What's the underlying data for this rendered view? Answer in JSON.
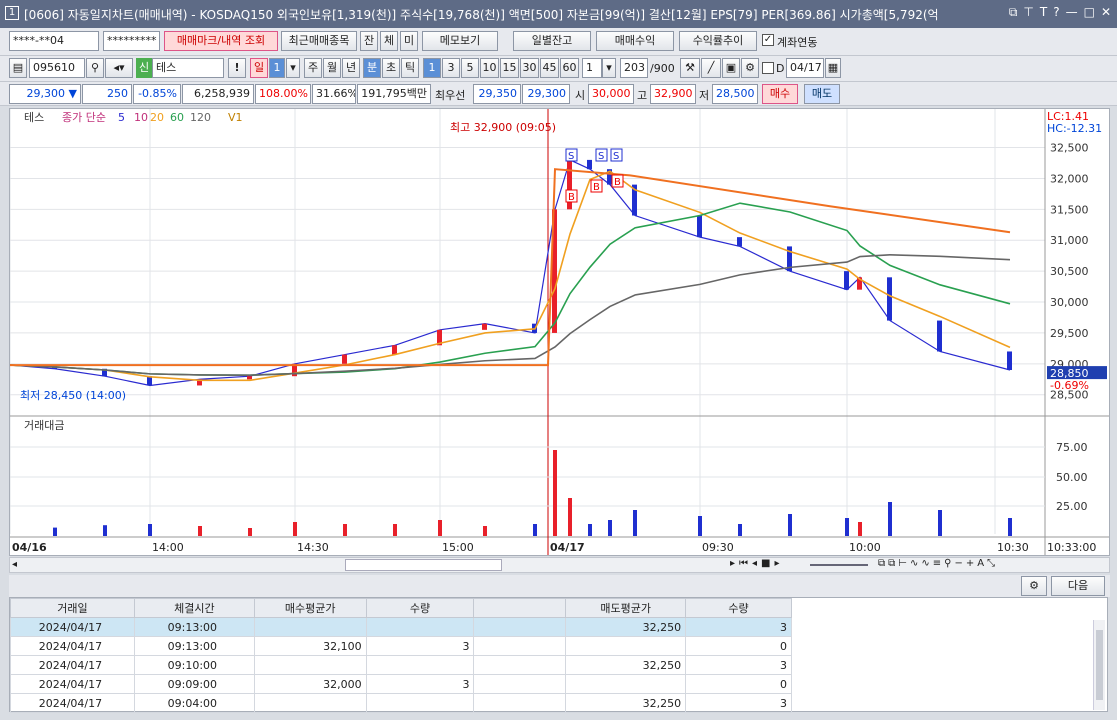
{
  "window": {
    "number": "1",
    "title": "[0606] 자동일지차트(매매내역) - KOSDAQ150 외국인보유[1,319(천)] 주식수[19,768(천)] 액면[500] 자본금[99(억)] 결산[12월] EPS[79] PER[369.86] 시가총액[5,792(억"
  },
  "row1": {
    "account": "****-**04",
    "password": "*********",
    "query_btn": "매매마크/내역 조회",
    "recent_btn": "최근매매종목",
    "tab_jan": "잔",
    "tab_che": "체",
    "tab_mi": "미",
    "memo_btn": "메모보기",
    "daily_btn": "일별잔고",
    "profit_btn": "매매수익",
    "trend_btn": "수익률추이",
    "link_label": "계좌연동"
  },
  "row2": {
    "code": "095610",
    "badge": "신",
    "name": "테스",
    "periods": [
      "일",
      "1",
      "주",
      "월",
      "년",
      "분",
      "초",
      "틱"
    ],
    "intervals": [
      "1",
      "3",
      "5",
      "10",
      "15",
      "30",
      "45",
      "60"
    ],
    "multiplier": "1",
    "count": "203",
    "max": "/900",
    "d_label": "D",
    "date": "04/17"
  },
  "row3": {
    "price": "29,300",
    "arrow": "▼",
    "change": "250",
    "pct": "-0.85%",
    "volume": "6,258,939",
    "vol_ratio": "108.00%",
    "turnover": "31.66%",
    "amount": "191,795백만",
    "best_label": "최우선",
    "best_ask": "29,350",
    "best_bid": "29,300",
    "open_label": "시",
    "open": "30,000",
    "high_label": "고",
    "high": "32,900",
    "low_label": "저",
    "low": "28,500",
    "buy_btn": "매수",
    "sell_btn": "매도"
  },
  "chart_data": {
    "type": "line",
    "legend": {
      "name": "테스",
      "ma_label": "종가 단순",
      "periods": [
        "5",
        "10",
        "20",
        "60",
        "120"
      ],
      "volume_label": "V1"
    },
    "y_ticks": [
      "32,500",
      "32,000",
      "31,500",
      "31,000",
      "30,500",
      "30,000",
      "29,500",
      "29,000",
      "28,500"
    ],
    "ylim": [
      28350,
      32800
    ],
    "lc": "LC:1.41",
    "hc": "HC:-12.31",
    "current_price": "28,850",
    "current_pct": "-0.69%",
    "high_annotation": "최고 32,900 (09:05)",
    "low_annotation": "최저 28,450 (14:00)",
    "x_ticks": [
      "04/16",
      "14:00",
      "14:30",
      "15:00",
      "04/17",
      "09:30",
      "10:00",
      "10:30"
    ],
    "time_label": "10:33:00",
    "volume_panel_title": "거래대금",
    "volume_ticks": [
      "75.00",
      "50.00",
      "25.00"
    ],
    "trade_marks": [
      "S",
      "S",
      "S",
      "B",
      "B",
      "B"
    ],
    "colors": {
      "up": "#e8202a",
      "down": "#1f2fd0",
      "ma5": "#2a2ad0",
      "ma20": "#f0a020",
      "ma60": "#29a050",
      "ma120": "#666666",
      "long": "#f07020"
    },
    "close_points": [
      {
        "t": "13:30",
        "p": 28980
      },
      {
        "t": "13:40",
        "p": 28920
      },
      {
        "t": "13:50",
        "p": 28800
      },
      {
        "t": "14:00",
        "p": 28650
      },
      {
        "t": "14:10",
        "p": 28750
      },
      {
        "t": "14:20",
        "p": 28800
      },
      {
        "t": "14:30",
        "p": 29000
      },
      {
        "t": "14:40",
        "p": 29150
      },
      {
        "t": "14:50",
        "p": 29300
      },
      {
        "t": "15:00",
        "p": 29550
      },
      {
        "t": "15:10",
        "p": 29650
      },
      {
        "t": "15:20",
        "p": 29500
      },
      {
        "t": "09:00",
        "p": 31500
      },
      {
        "t": "09:05",
        "p": 32300
      },
      {
        "t": "09:10",
        "p": 32150
      },
      {
        "t": "09:15",
        "p": 31900
      },
      {
        "t": "09:20",
        "p": 31400
      },
      {
        "t": "09:30",
        "p": 31050
      },
      {
        "t": "09:40",
        "p": 30900
      },
      {
        "t": "09:50",
        "p": 30500
      },
      {
        "t": "10:00",
        "p": 30200
      },
      {
        "t": "10:05",
        "p": 30400
      },
      {
        "t": "10:10",
        "p": 29700
      },
      {
        "t": "10:20",
        "p": 29200
      },
      {
        "t": "10:30",
        "p": 28900
      }
    ]
  },
  "bottom": {
    "next_btn": "다음",
    "headers": [
      "거래일",
      "체결시간",
      "매수평균가",
      "수량",
      "",
      "매도평균가",
      "수량"
    ],
    "rows": [
      [
        "2024/04/17",
        "09:13:00",
        "",
        "",
        "",
        "32,250",
        "3"
      ],
      [
        "2024/04/17",
        "09:13:00",
        "32,100",
        "3",
        "",
        "",
        "0"
      ],
      [
        "2024/04/17",
        "09:10:00",
        "",
        "",
        "",
        "32,250",
        "3"
      ],
      [
        "2024/04/17",
        "09:09:00",
        "32,000",
        "3",
        "",
        "",
        "0"
      ],
      [
        "2024/04/17",
        "09:04:00",
        "",
        "",
        "",
        "32,250",
        "3"
      ]
    ]
  }
}
